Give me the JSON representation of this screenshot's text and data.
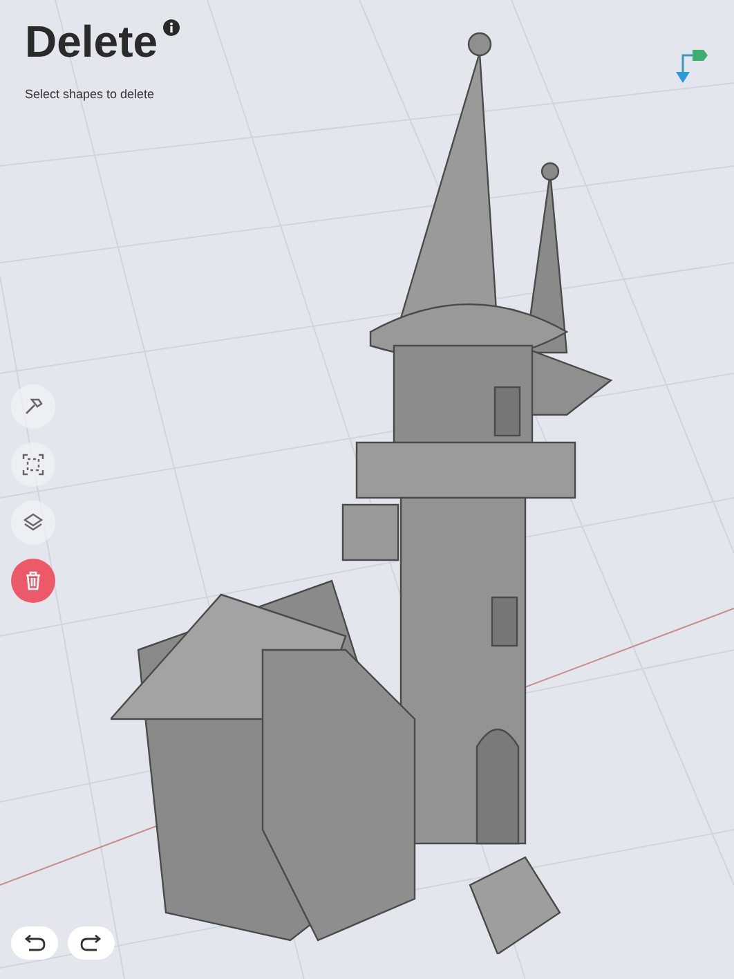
{
  "header": {
    "title": "Delete",
    "subtitle": "Select shapes to delete"
  },
  "tools": [
    {
      "kind": "hammer",
      "selected": false
    },
    {
      "kind": "transform",
      "selected": false
    },
    {
      "kind": "layers",
      "selected": false
    },
    {
      "kind": "delete",
      "selected": true
    }
  ],
  "history": [
    {
      "kind": "undo"
    },
    {
      "kind": "redo"
    }
  ]
}
